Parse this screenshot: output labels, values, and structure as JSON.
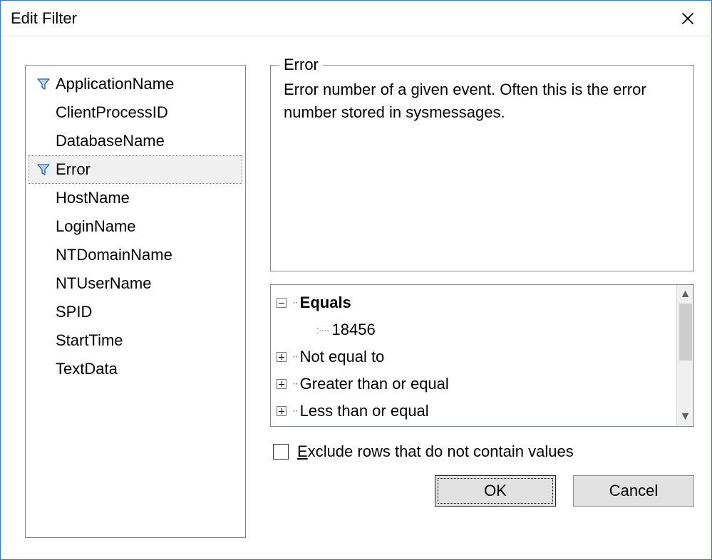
{
  "window": {
    "title": "Edit Filter"
  },
  "filters": {
    "items": [
      {
        "label": "ApplicationName",
        "hasFilter": true,
        "selected": false
      },
      {
        "label": "ClientProcessID",
        "hasFilter": false,
        "selected": false
      },
      {
        "label": "DatabaseName",
        "hasFilter": false,
        "selected": false
      },
      {
        "label": "Error",
        "hasFilter": true,
        "selected": true
      },
      {
        "label": "HostName",
        "hasFilter": false,
        "selected": false
      },
      {
        "label": "LoginName",
        "hasFilter": false,
        "selected": false
      },
      {
        "label": "NTDomainName",
        "hasFilter": false,
        "selected": false
      },
      {
        "label": "NTUserName",
        "hasFilter": false,
        "selected": false
      },
      {
        "label": "SPID",
        "hasFilter": false,
        "selected": false
      },
      {
        "label": "StartTime",
        "hasFilter": false,
        "selected": false
      },
      {
        "label": "TextData",
        "hasFilter": false,
        "selected": false
      }
    ]
  },
  "detail": {
    "group_title": "Error",
    "description": "Error number of a given event. Often this is the error number stored in sysmessages."
  },
  "tree": {
    "nodes": [
      {
        "label": "Equals",
        "expanded": true,
        "bold": true,
        "children": [
          "18456"
        ]
      },
      {
        "label": "Not equal to",
        "expanded": false,
        "bold": false,
        "children": []
      },
      {
        "label": "Greater than or equal",
        "expanded": false,
        "bold": false,
        "children": []
      },
      {
        "label": "Less than or equal",
        "expanded": false,
        "bold": false,
        "children": []
      }
    ]
  },
  "exclude": {
    "checked": false,
    "label_prefix": "E",
    "label_rest": "xclude rows that do not contain values"
  },
  "buttons": {
    "ok": "OK",
    "cancel": "Cancel"
  }
}
